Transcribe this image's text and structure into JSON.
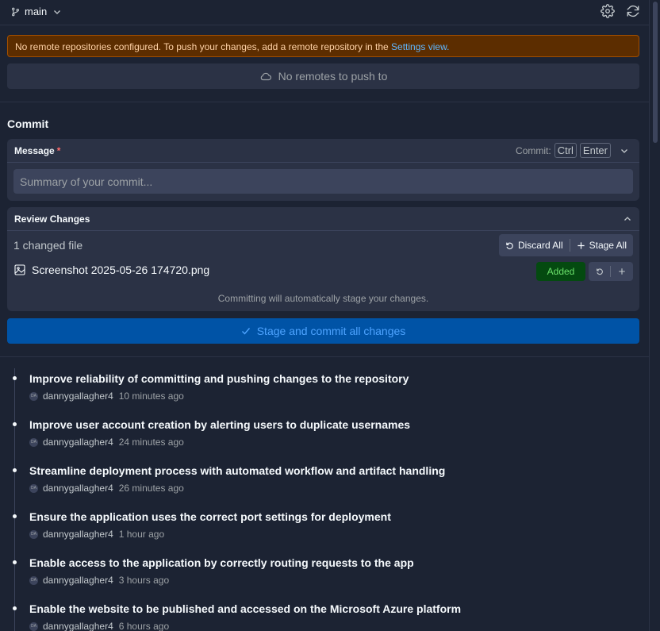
{
  "header": {
    "branch": "main",
    "settings_icon": "gear-icon",
    "sync_icon": "refresh-icon"
  },
  "warning": {
    "text": "No remote repositories configured. To push your changes, add a remote repository in the ",
    "link": "Settings view."
  },
  "push": {
    "label": "No remotes to push to"
  },
  "commit": {
    "heading": "Commit",
    "message_label": "Message",
    "required_mark": "*",
    "shortcut_label": "Commit:",
    "key1": "Ctrl",
    "key2": "Enter",
    "placeholder": "Summary of your commit..."
  },
  "review": {
    "heading": "Review Changes",
    "changed_count": "1 changed file",
    "discard_all": "Discard All",
    "stage_all": "Stage All",
    "files": [
      {
        "name": "Screenshot 2025-05-26 174720.png",
        "status": "Added"
      }
    ],
    "auto_stage_note": "Committing will automatically stage your changes."
  },
  "stage_commit_button": "Stage and commit all changes",
  "history": [
    {
      "title": "Improve reliability of committing and pushing changes to the repository",
      "avatar": "DA",
      "author": "dannygallagher4",
      "time": "10 minutes ago"
    },
    {
      "title": "Improve user account creation by alerting users to duplicate usernames",
      "avatar": "DA",
      "author": "dannygallagher4",
      "time": "24 minutes ago"
    },
    {
      "title": "Streamline deployment process with automated workflow and artifact handling",
      "avatar": "DA",
      "author": "dannygallagher4",
      "time": "26 minutes ago"
    },
    {
      "title": "Ensure the application uses the correct port settings for deployment",
      "avatar": "DA",
      "author": "dannygallagher4",
      "time": "1 hour ago"
    },
    {
      "title": "Enable access to the application by correctly routing requests to the app",
      "avatar": "DA",
      "author": "dannygallagher4",
      "time": "3 hours ago"
    },
    {
      "title": "Enable the website to be published and accessed on the Microsoft Azure platform",
      "avatar": "DA",
      "author": "dannygallagher4",
      "time": "6 hours ago"
    }
  ],
  "colors": {
    "background": "#1c2333",
    "surface": "#2b3245",
    "warning_bg": "#5c2d00",
    "warning_border": "#a24f00",
    "accent": "#0053a6",
    "added": "#044a10"
  }
}
